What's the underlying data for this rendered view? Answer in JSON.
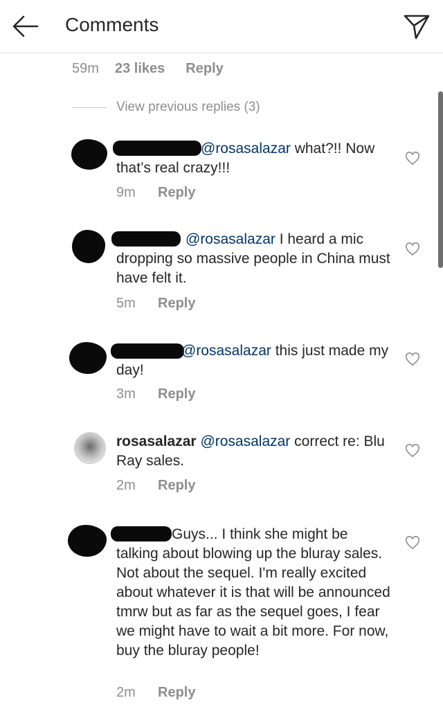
{
  "header": {
    "title": "Comments",
    "back_icon": "arrow-left-icon",
    "send_icon": "paper-plane-icon"
  },
  "parent_comment": {
    "time": "59m",
    "likes": "23 likes",
    "reply": "Reply"
  },
  "view_previous": "View previous replies (3)",
  "comments": [
    {
      "mention": "@rosasalazar",
      "text": " what?!! Now that’s real crazy!!!",
      "time": "9m",
      "reply": "Reply"
    },
    {
      "mention": "@rosasalazar",
      "text": " I heard a mic dropping so massive people in China must have felt it.",
      "time": "5m",
      "reply": "Reply"
    },
    {
      "mention": "@rosasalazar",
      "text": " this just made my day!",
      "time": "3m",
      "reply": "Reply"
    },
    {
      "username": "rosasalazar",
      "mention": "@rosasalazar",
      "text": " correct re: Blu Ray sales.",
      "time": "2m",
      "reply": "Reply"
    },
    {
      "text": "Guys... I think she might be talking about blowing up the bluray sales. Not about the sequel. I'm really excited about whatever it is that will be announced tmrw but as far as the sequel goes, I fear we might have to wait a bit more. For now, buy the bluray people!",
      "time": "2m",
      "reply": "Reply"
    }
  ],
  "colors": {
    "mention": "#003569",
    "secondary_text": "#8e8e8e",
    "primary_text": "#262626"
  }
}
